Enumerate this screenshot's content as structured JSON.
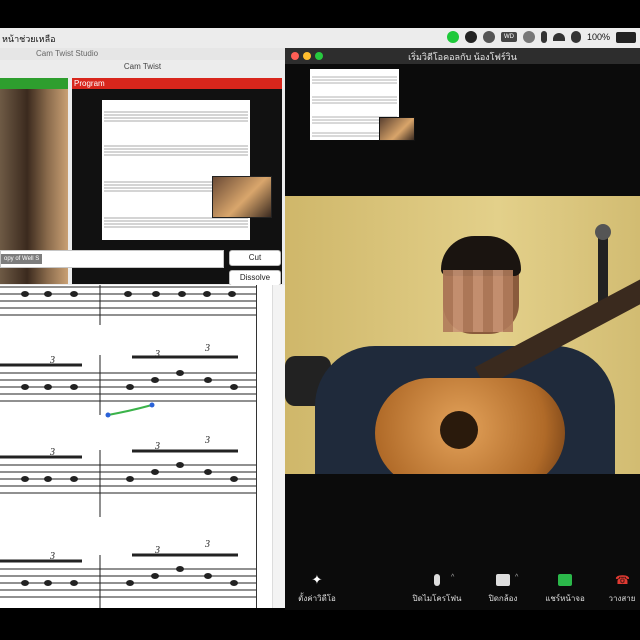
{
  "menubar": {
    "left_label": "หน้าช่วยเหลือ",
    "battery": "100%",
    "wd_badge": "WD"
  },
  "camtwist": {
    "studio_title": "Cam Twist Studio",
    "window_title": "Cam Twist",
    "program_label": "Program",
    "source_chip": "opy of Well S",
    "cut_label": "Cut",
    "dissolve_label": "Dissolve"
  },
  "zoom": {
    "title": "เริ่มวิดีโอคอลกับ น้องโฟร์วิน",
    "toolbar": {
      "video_settings": "ตั้งค่าวิดีโอ",
      "mic": "ปิดไมโครโฟน",
      "camera": "ปิดกล้อง",
      "share": "แชร์หน้าจอ",
      "leave": "วางสาย"
    }
  },
  "colors": {
    "program_red": "#d8261c",
    "preview_green": "#2e9e2e",
    "share_green": "#2bb84a",
    "leave_red": "#e23a32"
  }
}
